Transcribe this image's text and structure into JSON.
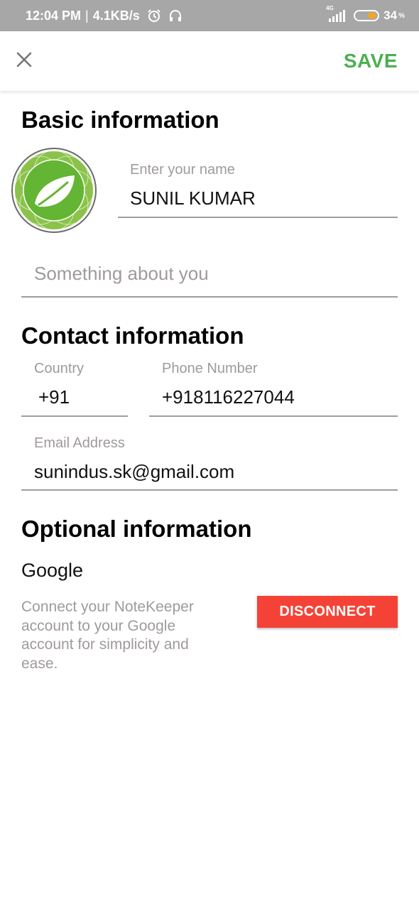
{
  "status_bar": {
    "time": "12:04 PM",
    "separator": "|",
    "speed": "4.1KB/s",
    "network": "4G",
    "battery": "34",
    "battery_unit": "%"
  },
  "appbar": {
    "save_label": "SAVE",
    "accent_color": "#4caf50"
  },
  "basic": {
    "heading": "Basic information",
    "name_label": "Enter your name",
    "name_value": "SUNIL KUMAR",
    "about_placeholder": "Something about you"
  },
  "contact": {
    "heading": "Contact information",
    "country_label": "Country",
    "country_value": "+91",
    "phone_label": "Phone Number",
    "phone_value": "+918116227044",
    "email_label": "Email Address",
    "email_value": "sunindus.sk@gmail.com"
  },
  "optional": {
    "heading": "Optional information",
    "google_title": "Google",
    "google_desc": "Connect your NoteKeeper account to your Google account for simplicity and ease.",
    "disconnect_label": "DISCONNECT",
    "disconnect_color": "#f44336"
  },
  "icons": {
    "close": "close-icon",
    "alarm": "alarm-icon",
    "headset": "headset-icon",
    "avatar": "spring-leaf-icon"
  }
}
